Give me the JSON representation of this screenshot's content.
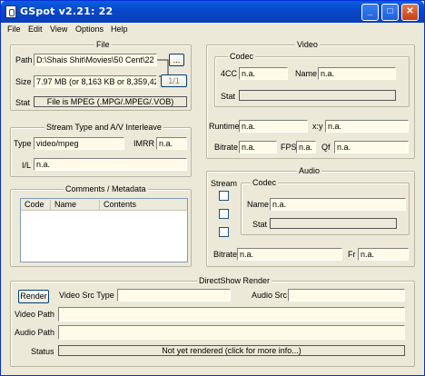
{
  "window": {
    "title": "GSpot v2.21: 22"
  },
  "titlebar": {
    "min": "_",
    "max": "□",
    "close": "✕"
  },
  "menu": [
    "File",
    "Edit",
    "View",
    "Options",
    "Help"
  ],
  "file": {
    "title": "File",
    "path_label": "Path",
    "path_value": "D:\\Shais Shit\\Movies\\50 Cent\\22",
    "browse": "...",
    "page": "1/1",
    "size_label": "Size",
    "size_value": "7.97 MB (or 8,163 KB or 8,359,42",
    "stat_label": "Stat",
    "stat_value": "File is MPEG (.MPG/.MPEG/.VOB)"
  },
  "stream": {
    "title": "Stream Type and A/V Interleave",
    "type_label": "Type",
    "type_value": "video/mpeg",
    "imrr_label": "IMRR",
    "imrr_value": "n.a.",
    "il_label": "I/L",
    "il_value": "n.a."
  },
  "comments": {
    "title": "Comments / Metadata",
    "columns": [
      "Code",
      "Name",
      "Contents"
    ]
  },
  "video": {
    "title": "Video",
    "codec_title": "Codec",
    "fourcc_label": "4CC",
    "fourcc_value": "n.a.",
    "name_label": "Name",
    "name_value": "n.a.",
    "stat_label": "Stat",
    "runtime_label": "Runtime",
    "runtime_value": "n.a.",
    "xy_label": "x:y",
    "xy_value": "n.a.",
    "bitrate_label": "Bitrate",
    "bitrate_value": "n.a.",
    "fps_label": "FPS",
    "fps_value": "n.a.",
    "qf_label": "Qf",
    "qf_value": "n.a."
  },
  "audio": {
    "title": "Audio",
    "stream_label": "Stream",
    "codec_title": "Codec",
    "name_label": "Name",
    "name_value": "n.a.",
    "stat_label": "Stat",
    "bitrate_label": "Bitrate",
    "bitrate_value": "n.a.",
    "fr_label": "Fr",
    "fr_value": "n.a."
  },
  "directshow": {
    "title": "DirectShow Render",
    "render_button": "Render",
    "video_src_label": "Video Src Type",
    "audio_src_label": "Audio Src",
    "video_path_label": "Video Path",
    "audio_path_label": "Audio Path",
    "status_label": "Status",
    "status_value": "Not yet rendered (click for more info...)"
  }
}
